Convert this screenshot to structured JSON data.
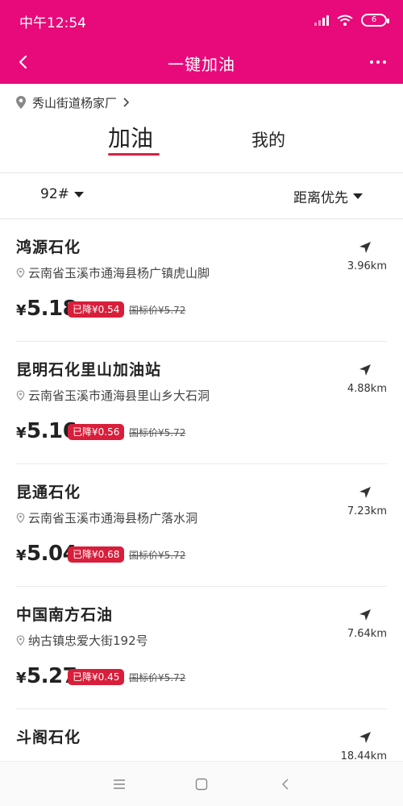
{
  "status_bar": {
    "time": "中午12:54",
    "battery": "6",
    "icons": [
      "signal-icon",
      "wifi-icon",
      "battery-icon"
    ]
  },
  "navbar": {
    "title": "一键加油",
    "back_icon": "chevron-left-icon",
    "more_icon": "more-dots-icon"
  },
  "location": {
    "text": "秀山街道杨家厂",
    "icon": "location-pin-icon"
  },
  "tabs": [
    {
      "label": "加油",
      "active": true
    },
    {
      "label": "我的",
      "active": false
    }
  ],
  "filters": {
    "fuel_type": "92#",
    "sort": "距离优先"
  },
  "stations": [
    {
      "name": "鸿源石化",
      "address": "云南省玉溪市通海县杨广镇虎山脚",
      "distance": "3.96km",
      "price_symbol": "¥",
      "price": "5.18",
      "drop": "已降¥0.54",
      "standard_price": "国标价¥5.72"
    },
    {
      "name": "昆明石化里山加油站",
      "address": "云南省玉溪市通海县里山乡大石洞",
      "distance": "4.88km",
      "price_symbol": "¥",
      "price": "5.16",
      "drop": "已降¥0.56",
      "standard_price": "国标价¥5.72"
    },
    {
      "name": "昆通石化",
      "address": "云南省玉溪市通海县杨广落水洞",
      "distance": "7.23km",
      "price_symbol": "¥",
      "price": "5.04",
      "drop": "已降¥0.68",
      "standard_price": "国标价¥5.72"
    },
    {
      "name": "中国南方石油",
      "address": "纳古镇忠爱大街192号",
      "distance": "7.64km",
      "price_symbol": "¥",
      "price": "5.27",
      "drop": "已降¥0.45",
      "standard_price": "国标价¥5.72"
    },
    {
      "name": "斗阁石化",
      "address": "",
      "distance": "18.44km",
      "price_symbol": "",
      "price": "",
      "drop": "",
      "standard_price": ""
    }
  ],
  "colors": {
    "brand": "#e8097a",
    "accent": "#d81e3a"
  },
  "system_nav": [
    "menu-icon",
    "home-square-icon",
    "back-triangle-icon"
  ]
}
